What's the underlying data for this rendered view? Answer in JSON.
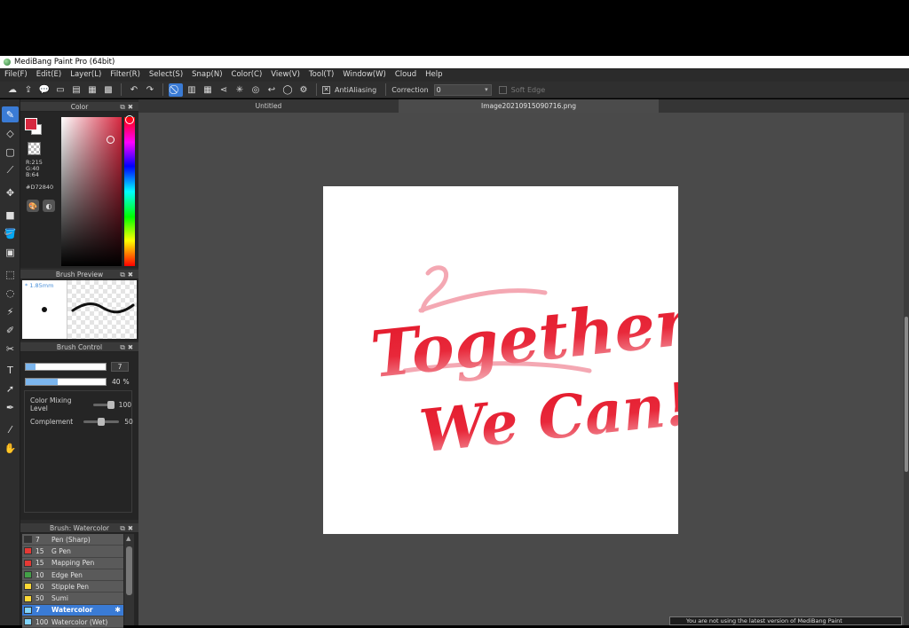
{
  "window": {
    "title": "MediBang Paint Pro (64bit)"
  },
  "menu": [
    "File(F)",
    "Edit(E)",
    "Layer(L)",
    "Filter(R)",
    "Select(S)",
    "Snap(N)",
    "Color(C)",
    "View(V)",
    "Tool(T)",
    "Window(W)",
    "Cloud",
    "Help"
  ],
  "toolbar": {
    "antialiasing_label": "AntiAliasing",
    "correction_label": "Correction",
    "correction_value": "0",
    "soft_edge_label": "Soft Edge"
  },
  "color_panel": {
    "title": "Color",
    "r": "R:215",
    "g": "G:40",
    "b": "B:64",
    "hex": "#D72840",
    "main_color": "#D72840"
  },
  "brush_preview": {
    "title": "Brush Preview",
    "size": "* 1.85mm"
  },
  "brush_control": {
    "title": "Brush Control",
    "size_value": "7",
    "opacity_value": "40",
    "opacity_unit": "%",
    "opacity_fraction": 0.4,
    "mixing_label": "Color Mixing Level",
    "mixing_value": "100",
    "complement_label": "Complement",
    "complement_value": "50"
  },
  "brush_list": {
    "title": "Brush: Watercolor",
    "items": [
      {
        "size": "7",
        "name": "Pen (Sharp)",
        "color": "#333333"
      },
      {
        "size": "15",
        "name": "G Pen",
        "color": "#e53935"
      },
      {
        "size": "15",
        "name": "Mapping Pen",
        "color": "#e53935"
      },
      {
        "size": "10",
        "name": "Edge Pen",
        "color": "#43a047"
      },
      {
        "size": "50",
        "name": "Stipple Pen",
        "color": "#fdd835"
      },
      {
        "size": "50",
        "name": "Sumi",
        "color": "#fdd835"
      },
      {
        "size": "7",
        "name": "Watercolor",
        "color": "#81d4fa"
      },
      {
        "size": "100",
        "name": "Watercolor (Wet)",
        "color": "#81d4fa"
      }
    ]
  },
  "tabs": [
    {
      "label": "Untitled"
    },
    {
      "label": "Image20210915090716.png"
    }
  ],
  "artwork": {
    "line1": "Together",
    "line2": "We Can!"
  },
  "notification": {
    "text": "You are not using the latest version of MediBang Paint"
  }
}
